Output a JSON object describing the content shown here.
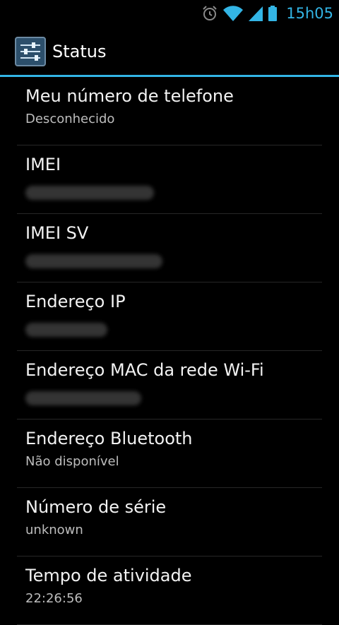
{
  "status_bar": {
    "time": "15h05",
    "icons": [
      "alarm-icon",
      "wifi-icon",
      "signal-icon",
      "battery-icon"
    ],
    "accent_color": "#33b5e5"
  },
  "action_bar": {
    "title": "Status",
    "icon": "settings-sliders-icon",
    "divider_color": "#33b5e5"
  },
  "items": [
    {
      "title": "Meu número de telefone",
      "summary": "Desconhecido"
    },
    {
      "title": "IMEI",
      "summary": ""
    },
    {
      "title": "IMEI SV",
      "summary": ""
    },
    {
      "title": "Endereço IP",
      "summary": ""
    },
    {
      "title": "Endereço MAC da rede Wi-Fi",
      "summary": ""
    },
    {
      "title": "Endereço Bluetooth",
      "summary": "Não disponível"
    },
    {
      "title": "Número de série",
      "summary": "unknown"
    },
    {
      "title": "Tempo de atividade",
      "summary": "22:26:56"
    }
  ]
}
